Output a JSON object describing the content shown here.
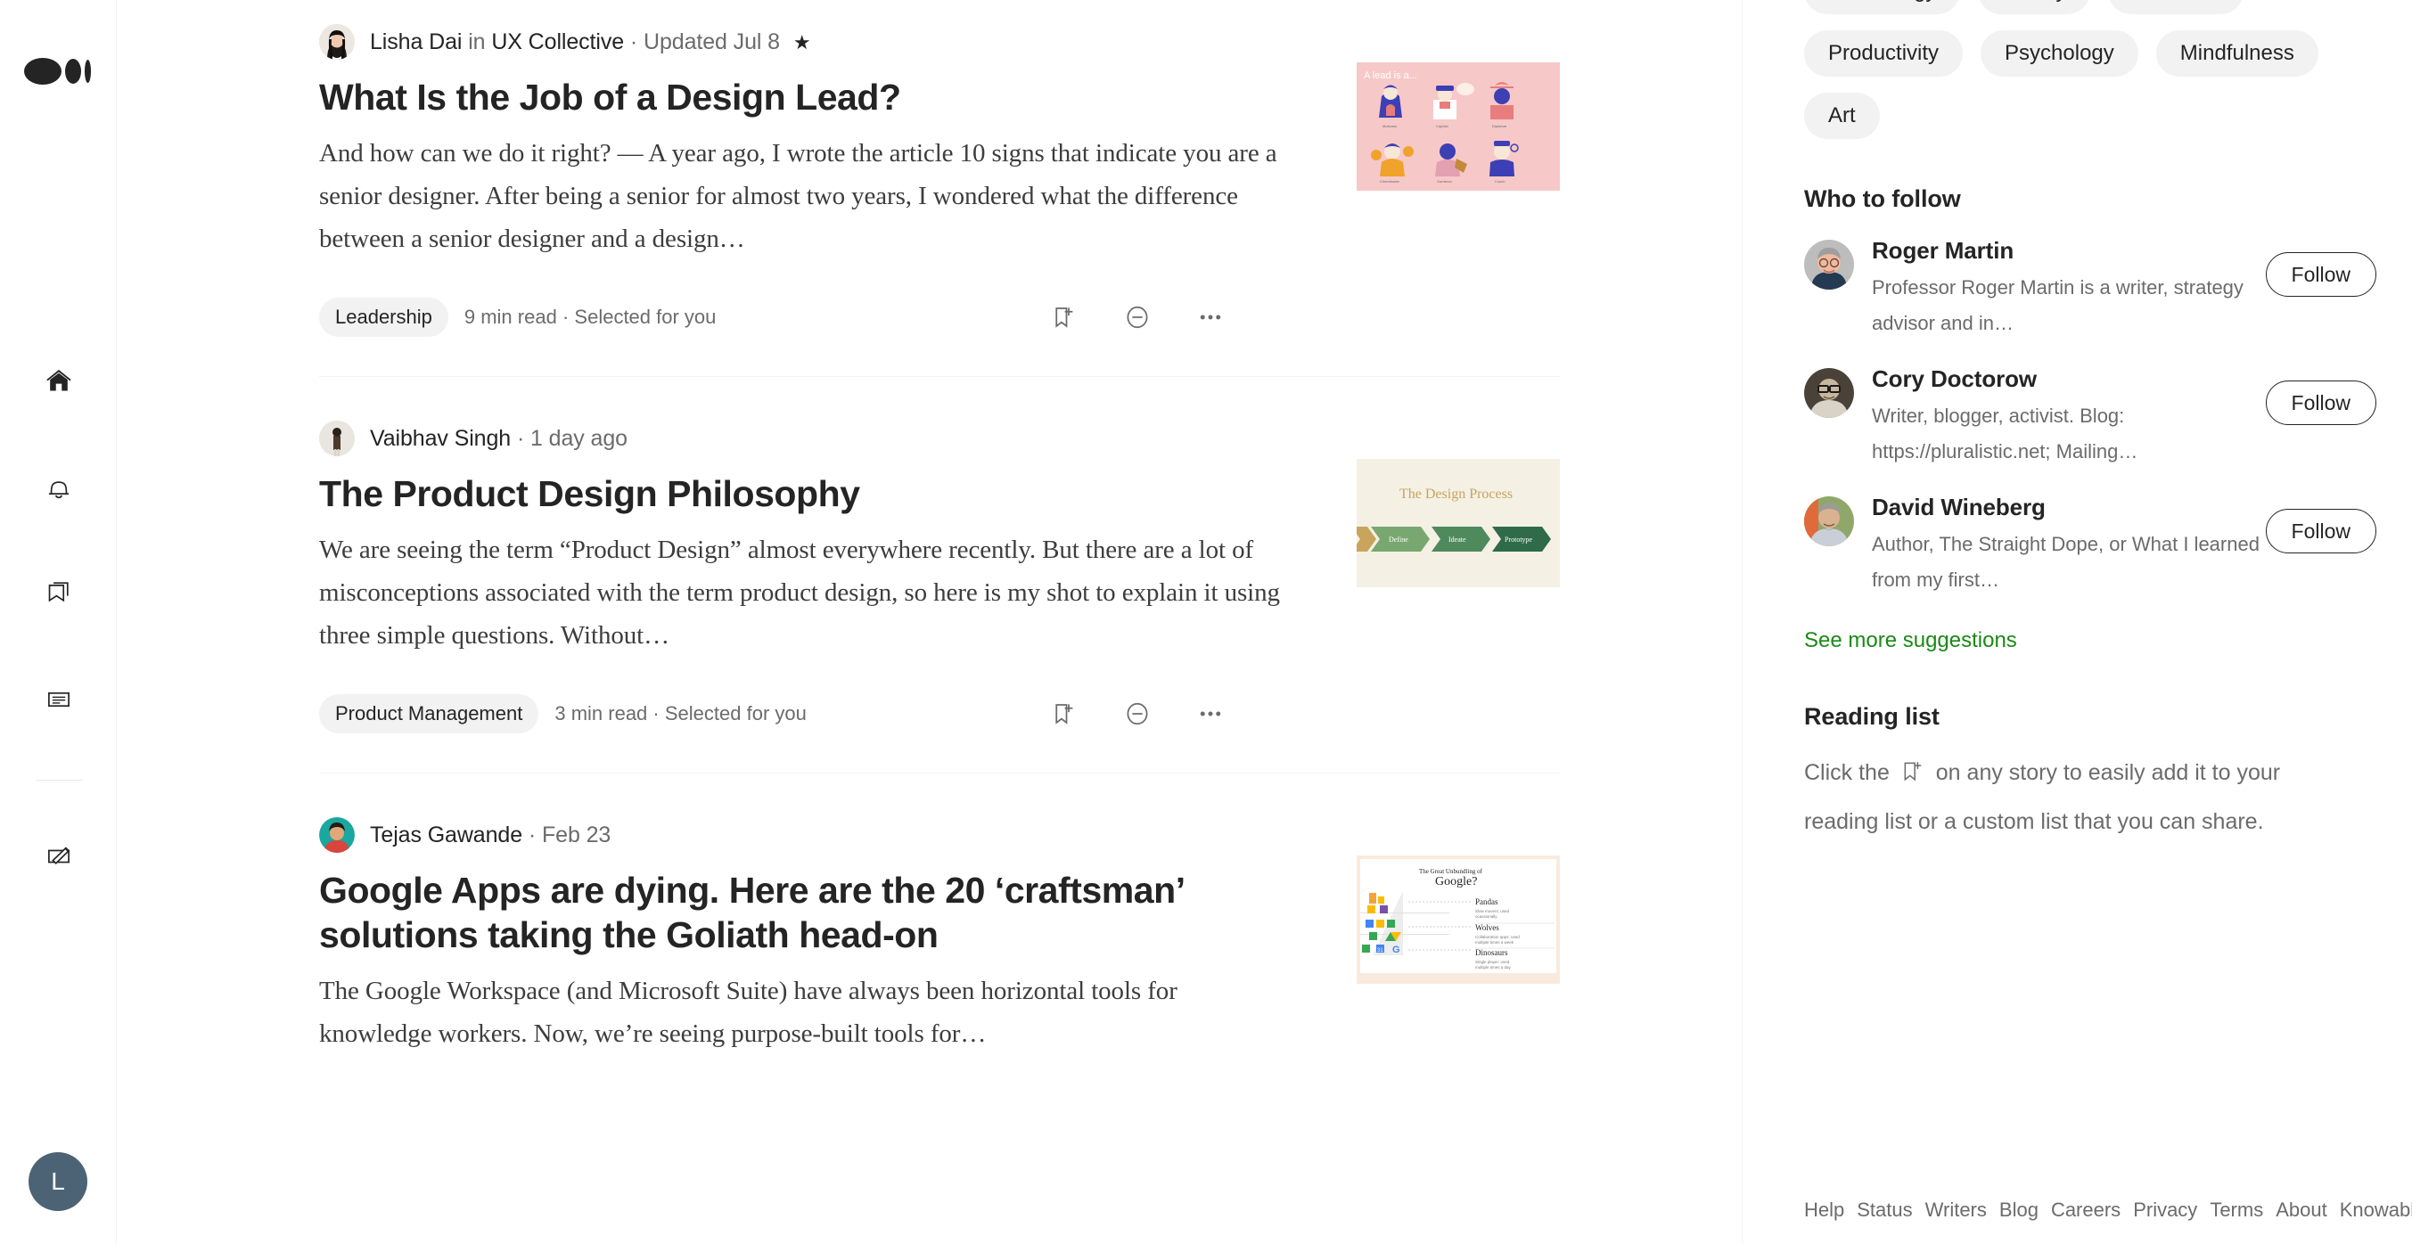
{
  "brand": {
    "logo_name": "medium-logo"
  },
  "left_rail": {
    "items": [
      {
        "name": "home-icon",
        "label": "Home"
      },
      {
        "name": "bell-icon",
        "label": "Notifications"
      },
      {
        "name": "bookmark-icon",
        "label": "Lists"
      },
      {
        "name": "stories-icon",
        "label": "Stories"
      },
      {
        "name": "write-icon",
        "label": "Write"
      }
    ],
    "avatar_initial": "L"
  },
  "feed": {
    "stories": [
      {
        "author": "Lisha Dai",
        "in_word": "in",
        "publication": "UX Collective",
        "separator": "·",
        "date": "Updated Jul 8",
        "star": "★",
        "has_publication": true,
        "title": "What Is the Job of a Design Lead?",
        "excerpt": "And how can we do it right? — A year ago, I wrote the article 10 signs that indicate you are a senior designer. After being a senior for almost two years, I wondered what the difference between a senior designer and a design…",
        "topic": "Leadership",
        "read_time": "9 min read",
        "meta_sep": "·",
        "reason": "Selected for you",
        "thumb": {
          "name": "design-lead-illustration",
          "caption": "A lead is a...",
          "bg": "#f7c8c8",
          "roles": [
            "Motivator",
            "Captain",
            "Diplomat",
            "Cheerleader",
            "Gardener",
            "Coach"
          ]
        }
      },
      {
        "author": "Vaibhav Singh",
        "in_word": "",
        "publication": "",
        "separator": "·",
        "date": "1 day ago",
        "star": "",
        "has_publication": false,
        "title": "The Product Design Philosophy",
        "excerpt": "We are seeing the term “Product Design” almost everywhere recently. But there are a lot of misconceptions associated with the term product design, so here is my shot to explain it using three simple questions. Without…",
        "topic": "Product Management",
        "read_time": "3 min read",
        "meta_sep": "·",
        "reason": "Selected for you",
        "thumb": {
          "name": "design-process-diagram",
          "caption": "The Design Process",
          "bg": "#f4f0e4",
          "steps": [
            "Define",
            "Ideate",
            "Prototype"
          ]
        }
      },
      {
        "author": "Tejas Gawande",
        "in_word": "",
        "publication": "",
        "separator": "·",
        "date": "Feb 23",
        "star": "",
        "has_publication": false,
        "title": "Google Apps are dying. Here are the 20 ‘craftsman’ solutions taking the Goliath head-on",
        "excerpt": "The Google Workspace (and Microsoft Suite) have always been horizontal tools for knowledge workers. Now, we’re seeing purpose-built tools for…",
        "topic": "",
        "read_time": "",
        "meta_sep": "",
        "reason": "",
        "thumb": {
          "name": "google-unbundling-pyramid",
          "caption_small": "The Great Unbundling of",
          "caption_large": "Google?",
          "bg": "#faeadd",
          "tiers": [
            {
              "name": "Pandas",
              "desc": "Slow movers; used ocassionally"
            },
            {
              "name": "Wolves",
              "desc": "Collaboration apps; used multiple times a week"
            },
            {
              "name": "Dinosaurs",
              "desc": "Single player; used multiple times a day"
            }
          ]
        }
      }
    ],
    "actions": {
      "bookmark": "add-to-list",
      "mute": "show-less-like-this",
      "more": "more-options"
    }
  },
  "sidebar": {
    "tags": [
      "Technology",
      "Money",
      "Business",
      "Productivity",
      "Psychology",
      "Mindfulness",
      "Art"
    ],
    "who_to_follow": {
      "heading": "Who to follow",
      "people": [
        {
          "name": "Roger Martin",
          "bio": "Professor Roger Martin is a writer, strategy advisor and in…",
          "follow_label": "Follow",
          "avatar_tone": "#c7c7c7"
        },
        {
          "name": "Cory Doctorow",
          "bio": "Writer, blogger, activist. Blog: https://pluralistic.net; Mailing…",
          "follow_label": "Follow",
          "avatar_tone": "#5a5248"
        },
        {
          "name": "David Wineberg",
          "bio": "Author, The Straight Dope, or What I learned from my first…",
          "follow_label": "Follow",
          "avatar_tone": "#8a8470"
        }
      ],
      "see_more": "See more suggestions",
      "see_more_color": "#1a8917"
    },
    "reading_list": {
      "heading": "Reading list",
      "text_before": "Click the",
      "icon_name": "bookmark-plus-icon",
      "text_after": "on any story to easily add it to your reading list or a custom list that you can share."
    },
    "footer_links": [
      "Help",
      "Status",
      "Writers",
      "Blog",
      "Careers",
      "Privacy",
      "Terms",
      "About",
      "Knowable"
    ]
  }
}
